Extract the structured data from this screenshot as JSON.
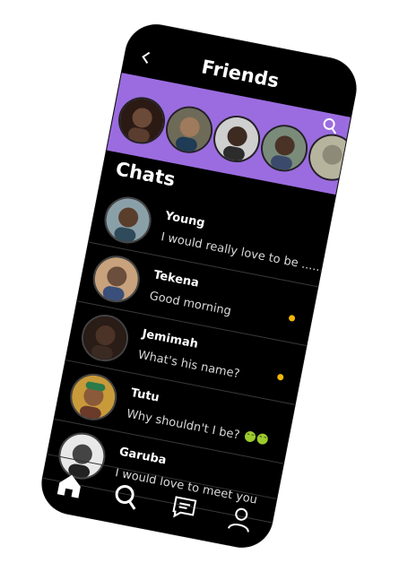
{
  "header": {
    "back_icon": "chevron-left-icon",
    "title": "Friends",
    "search_icon": "search-icon"
  },
  "friends": [
    {
      "name": "friend-1",
      "tone": "#6b4a38"
    },
    {
      "name": "friend-2",
      "tone": "#a07a5c"
    },
    {
      "name": "friend-3",
      "tone": "#3d2a20"
    },
    {
      "name": "friend-4",
      "tone": "#4a3226"
    },
    {
      "name": "friend-5",
      "tone": "#8e8a78"
    }
  ],
  "chats_title": "Chats",
  "chats": [
    {
      "name": "Young",
      "message": "I would really love to be .......",
      "unread": false,
      "tone": "#5a3e2c"
    },
    {
      "name": "Tekena",
      "message": "Good morning",
      "unread": true,
      "tone": "#6b4e3b"
    },
    {
      "name": "Jemimah",
      "message": "What's his name?",
      "unread": true,
      "tone": "#4b3327"
    },
    {
      "name": "Tutu",
      "message": "Why shouldn't I be?",
      "unread": false,
      "tone": "#8a5a3a"
    },
    {
      "name": "Garuba",
      "message": "I would love to meet you",
      "unread": false,
      "tone": "#777777"
    }
  ],
  "nav": {
    "home": "home-icon",
    "search": "search-icon",
    "messages": "chat-icon",
    "profile": "user-icon"
  },
  "colors": {
    "accent": "#9b6ce0",
    "unread": "#f2b705",
    "background": "#000000"
  }
}
